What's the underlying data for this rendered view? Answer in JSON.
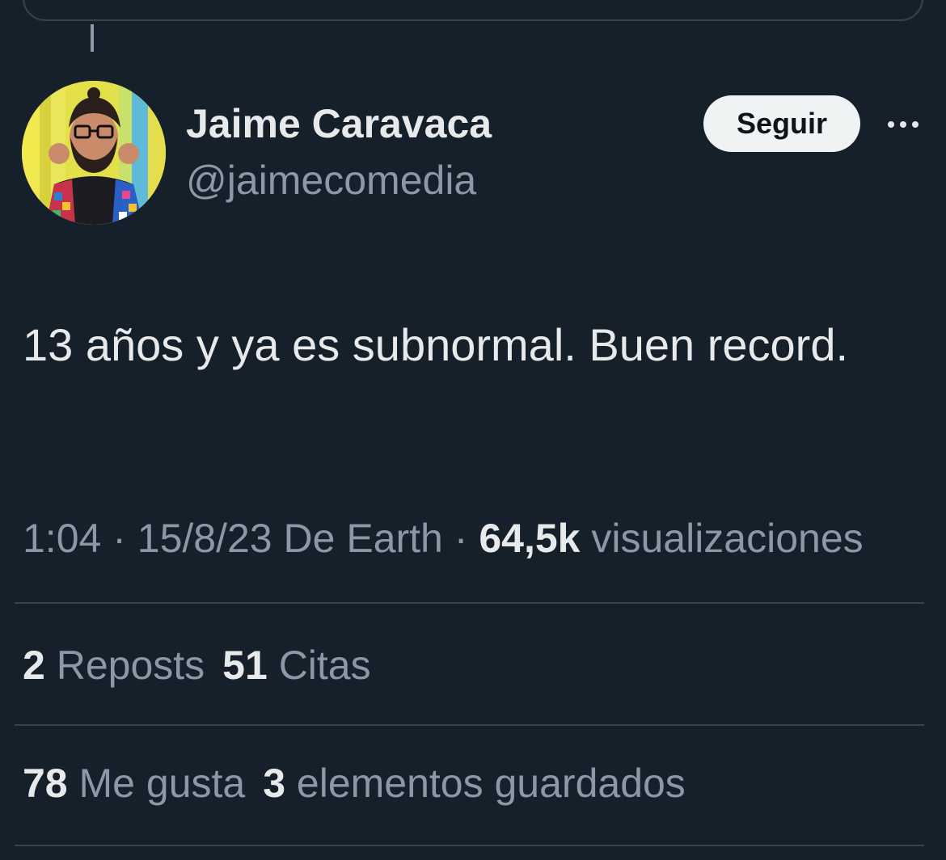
{
  "author": {
    "display_name": "Jaime Caravaca",
    "handle": "@jaimecomedia",
    "avatar_icon": "avatar-photo"
  },
  "actions": {
    "follow_label": "Seguir",
    "more_icon": "more-horizontal-icon"
  },
  "tweet": {
    "text": "13 años y ya es subnormal. Buen record."
  },
  "meta": {
    "time": "1:04",
    "separator": "·",
    "date": "15/8/23",
    "source": "De Earth",
    "views_count": "64,5k",
    "views_label": "visualizaciones"
  },
  "stats": {
    "reposts_count": "2",
    "reposts_label": "Reposts",
    "quotes_count": "51",
    "quotes_label": "Citas",
    "likes_count": "78",
    "likes_label": "Me gusta",
    "bookmarks_count": "3",
    "bookmarks_label": "elementos guardados"
  },
  "colors": {
    "background": "#15202b",
    "primary_text": "#e7e9ea",
    "secondary_text": "#8b98a5",
    "divider": "#38444d",
    "button_bg": "#eff3f4"
  }
}
